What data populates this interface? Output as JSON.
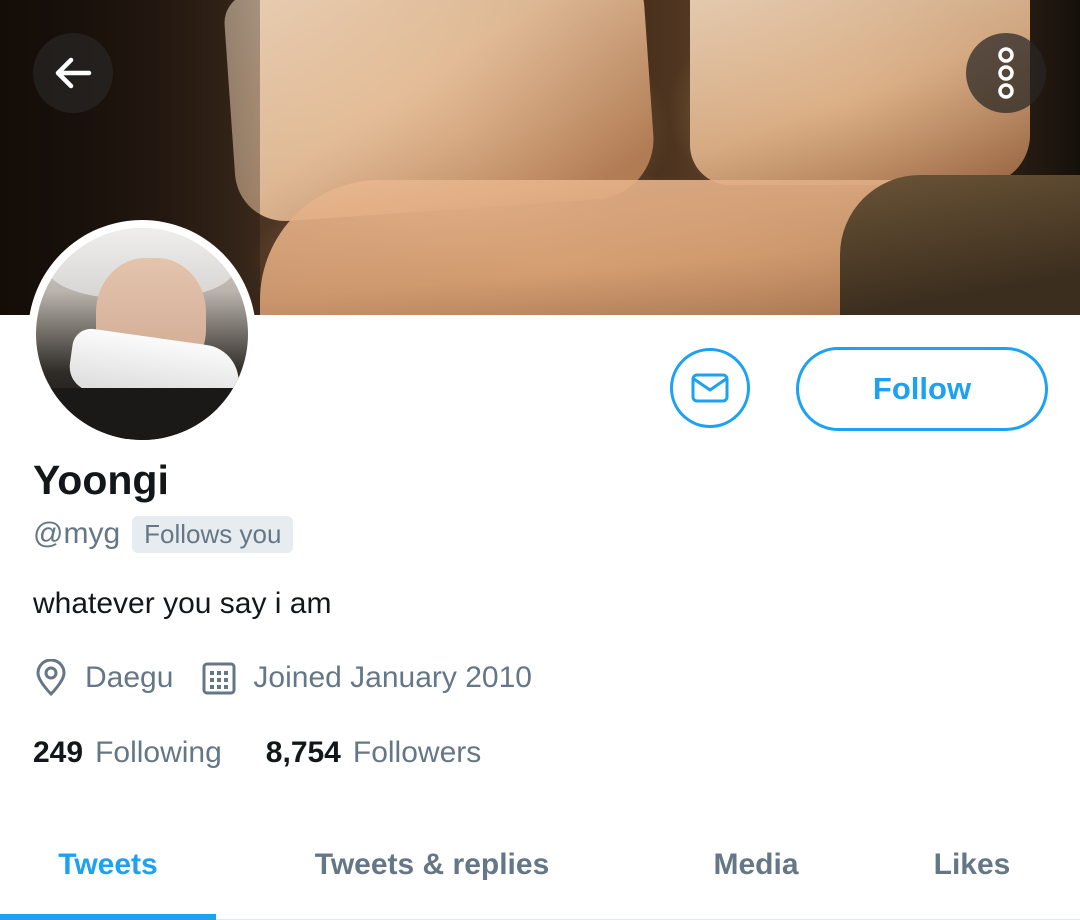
{
  "header": {
    "back_icon": "arrow-left-icon",
    "more_icon": "more-vertical-icon"
  },
  "actions": {
    "message_icon": "envelope-icon",
    "follow_label": "Follow"
  },
  "profile": {
    "name": "Yoongi",
    "handle": "@myg",
    "follows_you_badge": "Follows you",
    "bio": "whatever you say i am",
    "location": "Daegu",
    "location_icon": "map-pin-icon",
    "joined": "Joined January 2010",
    "joined_icon": "calendar-icon"
  },
  "stats": {
    "following_count": "249",
    "following_label": "Following",
    "followers_count": "8,754",
    "followers_label": "Followers"
  },
  "tabs": [
    {
      "label": "Tweets",
      "active": true
    },
    {
      "label": "Tweets & replies",
      "active": false
    },
    {
      "label": "Media",
      "active": false
    },
    {
      "label": "Likes",
      "active": false
    }
  ],
  "colors": {
    "accent": "#1da1f2",
    "secondary_text": "#657786",
    "primary_text": "#14171a"
  }
}
